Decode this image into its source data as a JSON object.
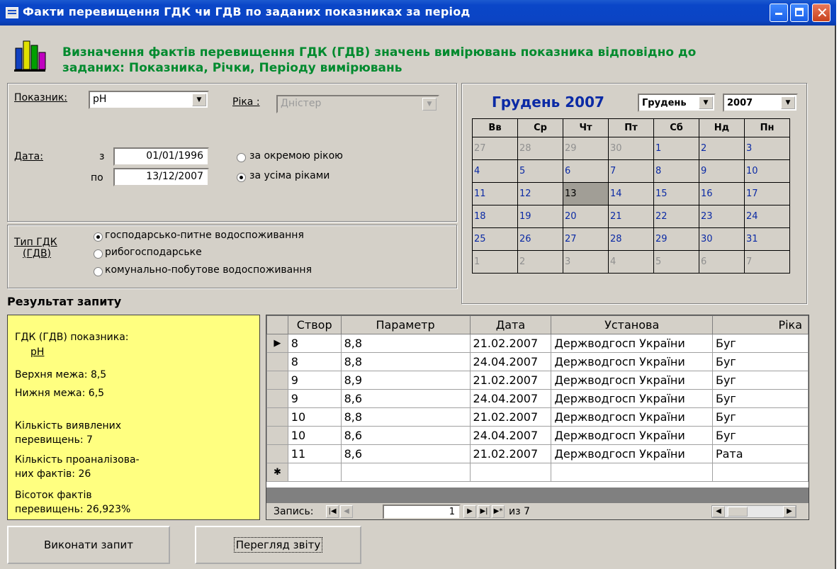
{
  "title": "Факти перевищення ГДК чи ГДВ по заданих показниках за період",
  "header_text": [
    "Визначення фактів перевищення ГДК (ГДВ) значень вимірювань показника відповідно до",
    "заданих: Показника, Річки, Періоду вимірювань"
  ],
  "filters": {
    "indicator_label": "Показник:",
    "indicator_value": "pH",
    "river_label": "Ріка :",
    "river_value": "Дністер",
    "date_label": "Дата:",
    "from_label": "з",
    "from_value": "01/01/1996",
    "to_label": "по",
    "to_value": "13/12/2007",
    "scope_options": [
      "за окремою рікою",
      "за усіма ріками"
    ],
    "scope_selected": 1
  },
  "type": {
    "label_line1": "Тип ГДК",
    "label_line2": "(ГДВ)",
    "options": [
      "господарсько-питне водоспоживання",
      "рибогосподарське",
      "комунально-побутове водоспоживання"
    ],
    "selected": 0
  },
  "calendar": {
    "title": "Грудень 2007",
    "month": "Грудень",
    "year": "2007",
    "weekdays": [
      "Вв",
      "Ср",
      "Чт",
      "Пт",
      "Сб",
      "Нд",
      "Пн"
    ],
    "weeks": [
      [
        "27",
        "28",
        "29",
        "30",
        "1",
        "2",
        "3"
      ],
      [
        "4",
        "5",
        "6",
        "7",
        "8",
        "9",
        "10"
      ],
      [
        "11",
        "12",
        "13",
        "14",
        "15",
        "16",
        "17"
      ],
      [
        "18",
        "19",
        "20",
        "21",
        "22",
        "23",
        "24"
      ],
      [
        "25",
        "26",
        "27",
        "28",
        "29",
        "30",
        "31"
      ],
      [
        "1",
        "2",
        "3",
        "4",
        "5",
        "6",
        "7"
      ]
    ],
    "selected_day": "13"
  },
  "result": {
    "title": "Результат запиту",
    "gdk_label": "ГДК (ГДВ) показника:",
    "gdk_value": "pH",
    "upper": "Верхня межа: 8,5",
    "lower": "Нижня межа:  6,5",
    "found_1": "Кількість виявлених",
    "found_2": "перевищень:  7",
    "analyzed_1": "Кількість проаналізова-",
    "analyzed_2": "них фактів: 26",
    "percent_1": "Вісоток фактів",
    "percent_2": "перевищень: 26,923%"
  },
  "grid": {
    "columns": [
      "Створ",
      "Параметр",
      "Дата",
      "Установа",
      "Ріка"
    ],
    "rows": [
      [
        "8",
        "8,8",
        "21.02.2007",
        "Держводгосп України",
        "Буг"
      ],
      [
        "8",
        "8,8",
        "24.04.2007",
        "Держводгосп України",
        "Буг"
      ],
      [
        "9",
        "8,9",
        "21.02.2007",
        "Держводгосп України",
        "Буг"
      ],
      [
        "9",
        "8,6",
        "24.04.2007",
        "Держводгосп України",
        "Буг"
      ],
      [
        "10",
        "8,8",
        "21.02.2007",
        "Держводгосп України",
        "Буг"
      ],
      [
        "10",
        "8,6",
        "24.04.2007",
        "Держводгосп України",
        "Буг"
      ],
      [
        "11",
        "8,6",
        "21.02.2007",
        "Держводгосп України",
        "Рата"
      ]
    ],
    "record_label": "Запись:",
    "record_current": "1",
    "record_of": "из  7"
  },
  "buttons": {
    "run": "Виконати запит",
    "report": "Перегляд звіту"
  }
}
